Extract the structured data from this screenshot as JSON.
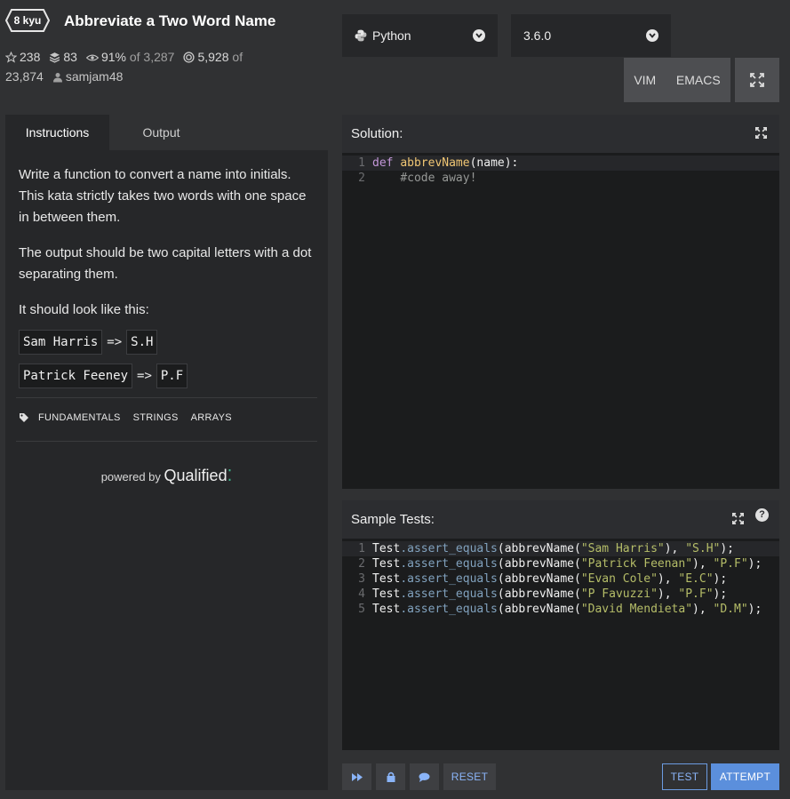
{
  "header": {
    "rank": "8 kyu",
    "title": "Abbreviate a Two Word Name",
    "stars": "238",
    "collections": "83",
    "satisfaction": "91%",
    "satisfaction_of": "of 3,287",
    "completed": "5,928",
    "completed_of": "of",
    "completed_total": "23,874",
    "author": "samjam48"
  },
  "language": {
    "label": "Python",
    "version": "3.6.0"
  },
  "editor_mode": {
    "vim": "VIM",
    "emacs": "EMACS"
  },
  "tabs": {
    "instructions": "Instructions",
    "output": "Output"
  },
  "instructions": {
    "p1": "Write a function to convert a name into initials. This kata strictly takes two words with one space in between them.",
    "p2": "The output should be two capital letters with a dot separating them.",
    "p3": "It should look like this:",
    "examples": [
      {
        "input": "Sam Harris",
        "arrow": "=>",
        "output": "S.H"
      },
      {
        "input": "Patrick Feeney",
        "arrow": "=>",
        "output": "P.F"
      }
    ]
  },
  "tags": [
    "FUNDAMENTALS",
    "STRINGS",
    "ARRAYS"
  ],
  "powered": {
    "prefix": "powered by",
    "brand": "Qualified"
  },
  "solution": {
    "title": "Solution:",
    "lines": [
      {
        "num": "1",
        "kw": "def",
        "fn": "abbrevName",
        "rest": "(name):"
      },
      {
        "num": "2",
        "indent": "    ",
        "comment": "#code away!"
      }
    ]
  },
  "sample_tests": {
    "title": "Sample Tests:",
    "help": "?",
    "lines": [
      {
        "num": "1",
        "obj": "Test",
        "method": ".assert_equals",
        "call": "(abbrevName(",
        "arg": "\"Sam Harris\"",
        "sep": "), ",
        "expected": "\"S.H\"",
        "end": ");"
      },
      {
        "num": "2",
        "obj": "Test",
        "method": ".assert_equals",
        "call": "(abbrevName(",
        "arg": "\"Patrick Feenan\"",
        "sep": "), ",
        "expected": "\"P.F\"",
        "end": ");"
      },
      {
        "num": "3",
        "obj": "Test",
        "method": ".assert_equals",
        "call": "(abbrevName(",
        "arg": "\"Evan Cole\"",
        "sep": "), ",
        "expected": "\"E.C\"",
        "end": ");"
      },
      {
        "num": "4",
        "obj": "Test",
        "method": ".assert_equals",
        "call": "(abbrevName(",
        "arg": "\"P Favuzzi\"",
        "sep": "), ",
        "expected": "\"P.F\"",
        "end": ");"
      },
      {
        "num": "5",
        "obj": "Test",
        "method": ".assert_equals",
        "call": "(abbrevName(",
        "arg": "\"David Mendieta\"",
        "sep": "), ",
        "expected": "\"D.M\"",
        "end": ");"
      }
    ]
  },
  "footer": {
    "reset": "RESET",
    "test": "TEST",
    "attempt": "ATTEMPT"
  },
  "colors": {
    "accent": "#5b8fdc",
    "panel": "#262729",
    "background": "#303133",
    "editor": "#1b1c1d"
  }
}
